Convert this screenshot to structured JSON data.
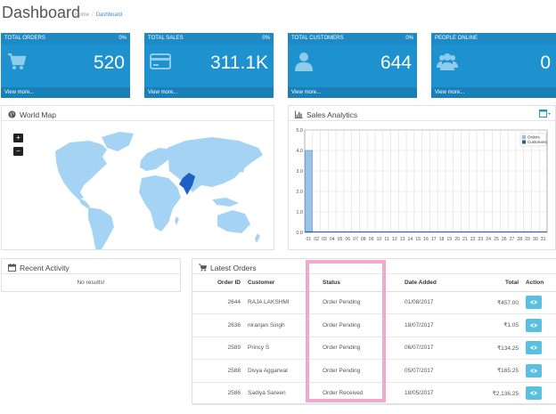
{
  "header": {
    "title": "Dashboard",
    "breadcrumb": [
      "Home",
      "Dashboard"
    ]
  },
  "tiles": [
    {
      "title": "TOTAL ORDERS",
      "percent": "0%",
      "value": "520",
      "footer": "View more...",
      "icon": "cart-icon"
    },
    {
      "title": "TOTAL SALES",
      "percent": "0%",
      "value": "311.1K",
      "footer": "View more...",
      "icon": "credit-card-icon"
    },
    {
      "title": "TOTAL CUSTOMERS",
      "percent": "0%",
      "value": "644",
      "footer": "View more...",
      "icon": "user-icon"
    },
    {
      "title": "PEOPLE ONLINE",
      "percent": "",
      "value": "0",
      "footer": "View more...",
      "icon": "users-icon"
    }
  ],
  "map": {
    "title": "World Map",
    "zoom_in": "+",
    "zoom_out": "−",
    "colors": {
      "land": "#a5d3f3",
      "highlight": "#1d5fc4"
    }
  },
  "sales": {
    "title": "Sales Analytics",
    "chart_data": {
      "type": "bar",
      "categories": [
        "01",
        "02",
        "03",
        "04",
        "05",
        "06",
        "07",
        "08",
        "09",
        "10",
        "11",
        "12",
        "13",
        "14",
        "15",
        "16",
        "17",
        "18",
        "19",
        "20",
        "21",
        "22",
        "23",
        "24",
        "25",
        "26",
        "27",
        "28",
        "29",
        "30",
        "31"
      ],
      "series": [
        {
          "name": "Orders",
          "values": [
            4,
            0,
            0,
            0,
            0,
            0,
            0,
            0,
            0,
            0,
            0,
            0,
            0,
            0,
            0,
            0,
            0,
            0,
            0,
            0,
            0,
            0,
            0,
            0,
            0,
            0,
            0,
            0,
            0,
            0,
            0
          ],
          "color": "#9cc2e5"
        },
        {
          "name": "Customers",
          "values": [
            0,
            0,
            0,
            0,
            0,
            0,
            0,
            0,
            0,
            0,
            0,
            0,
            0,
            0,
            0,
            0,
            0,
            0,
            0,
            0,
            0,
            0,
            0,
            0,
            0,
            0,
            0,
            0,
            0,
            0,
            0
          ],
          "color": "#1f5aa8"
        }
      ],
      "yticks": [
        "5.0",
        "4.0",
        "3.0",
        "2.0",
        "1.0",
        "0.0"
      ],
      "ylim": [
        0,
        5
      ],
      "grid": true,
      "legend": "top-right"
    }
  },
  "activity": {
    "title": "Recent Activity",
    "empty": "No results!"
  },
  "orders": {
    "title": "Latest Orders",
    "columns": {
      "id": "Order ID",
      "customer": "Customer",
      "status": "Status",
      "date": "Date Added",
      "total": "Total",
      "action": "Action"
    },
    "rows": [
      {
        "id": "2644",
        "customer": "RAJA LAKSHMI",
        "status": "Order Pending",
        "date": "01/08/2017",
        "total": "₹457.00"
      },
      {
        "id": "2636",
        "customer": "niranjan Singh",
        "status": "Order Pending",
        "date": "18/07/2017",
        "total": "₹1.05"
      },
      {
        "id": "2589",
        "customer": "Princy S",
        "status": "Order Pending",
        "date": "06/07/2017",
        "total": "₹134.25"
      },
      {
        "id": "2588",
        "customer": "Divya Aggarwal",
        "status": "Order Pending",
        "date": "05/07/2017",
        "total": "₹165.25"
      },
      {
        "id": "2586",
        "customer": "Sadiya Sareen",
        "status": "Order Received",
        "date": "18/05/2017",
        "total": "₹2,136.25"
      }
    ]
  }
}
